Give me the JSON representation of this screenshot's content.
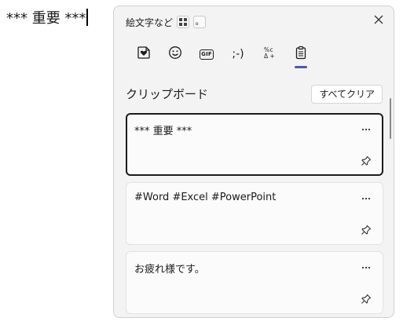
{
  "document": {
    "text": "*** 重要 ***"
  },
  "panel": {
    "title": "絵文字など",
    "shortcut_key": "。",
    "tabs": [
      {
        "name": "kaomoji-sticker",
        "icon": "heart-sticker-icon"
      },
      {
        "name": "emoji",
        "icon": "smiley-icon"
      },
      {
        "name": "gif",
        "label": "GIF",
        "icon": "gif-icon"
      },
      {
        "name": "kaomoji",
        "label": ";-)",
        "icon": "kaomoji-text"
      },
      {
        "name": "symbols",
        "icon": "symbols-icon"
      },
      {
        "name": "clipboard",
        "icon": "clipboard-icon",
        "active": true
      }
    ],
    "section_title": "クリップボード",
    "clear_all_label": "すべてクリア",
    "items": [
      {
        "text": "*** 重要 ***",
        "selected": true
      },
      {
        "text": "#Word #Excel #PowerPoint",
        "selected": false
      },
      {
        "text": "お疲れ様です。",
        "selected": false
      }
    ]
  },
  "colors": {
    "accent": "#4a5aa8",
    "panel_bg": "#f3f3f3",
    "card_bg": "#fbfbfb"
  }
}
